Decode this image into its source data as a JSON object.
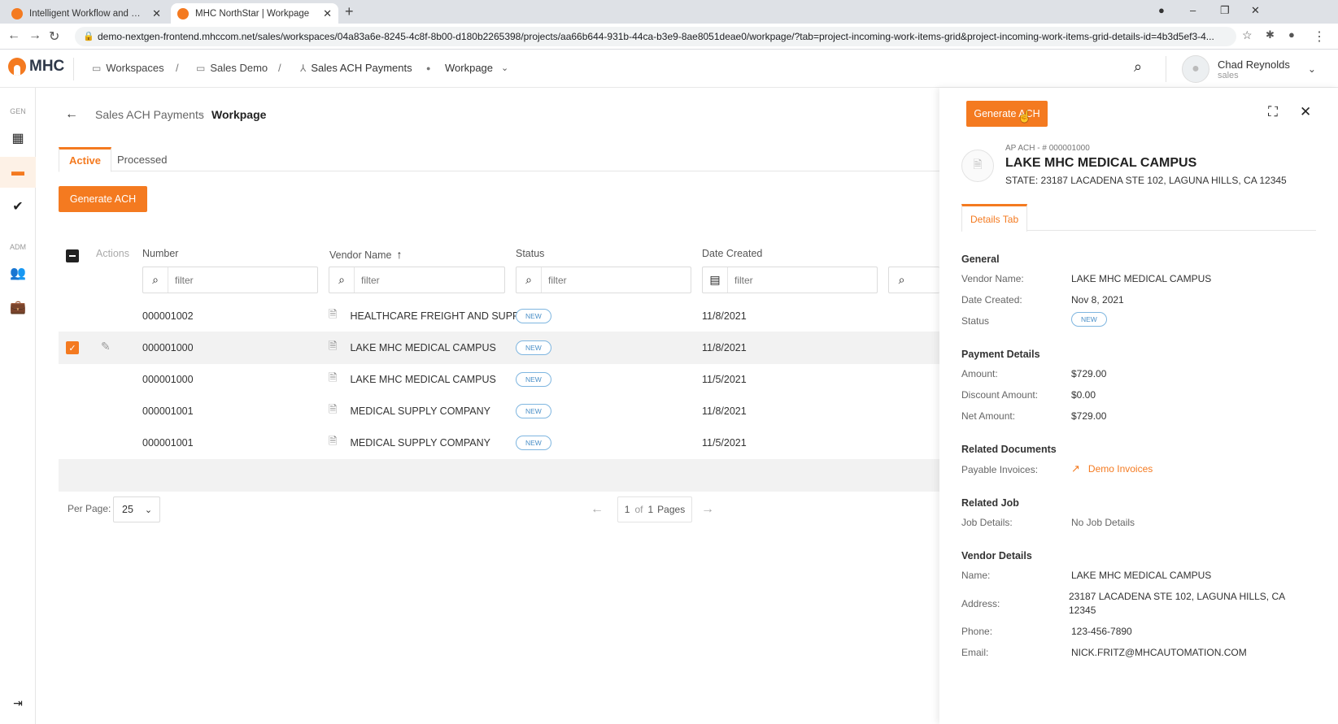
{
  "browser": {
    "tabs": [
      {
        "title": "Intelligent Workflow and Conten"
      },
      {
        "title": "MHC NorthStar | Workpage"
      }
    ],
    "url": "demo-nextgen-frontend.mhccom.net/sales/workspaces/04a83a6e-8245-4c8f-8b00-d180b2265398/projects/aa66b644-931b-44ca-b3e9-8ae8051deae0/workpage/?tab=project-incoming-work-items-grid&project-incoming-work-items-grid-details-id=4b3d5ef3-4..."
  },
  "header": {
    "logo_text": "MHC",
    "breadcrumb": [
      "Workspaces",
      "Sales Demo",
      "Sales ACH Payments",
      "Workpage"
    ],
    "user_name": "Chad Reynolds",
    "user_role": "sales"
  },
  "rail": {
    "gen_label": "GEN",
    "adm_label": "ADM"
  },
  "page": {
    "parent": "Sales ACH Payments",
    "title": "Workpage",
    "tabs": [
      "Active",
      "Processed"
    ],
    "generate_label": "Generate ACH"
  },
  "table": {
    "columns": [
      "Actions",
      "Number",
      "Vendor Name",
      "Status",
      "Date Created"
    ],
    "filter_placeholder": "filter",
    "rows": [
      {
        "number": "000001002",
        "vendor": "HEALTHCARE FREIGHT AND SUPPLY",
        "status": "NEW",
        "date": "11/8/2021"
      },
      {
        "number": "000001000",
        "vendor": "LAKE MHC MEDICAL CAMPUS",
        "status": "NEW",
        "date": "11/8/2021"
      },
      {
        "number": "000001000",
        "vendor": "LAKE MHC MEDICAL CAMPUS",
        "status": "NEW",
        "date": "11/5/2021"
      },
      {
        "number": "000001001",
        "vendor": "MEDICAL SUPPLY COMPANY",
        "status": "NEW",
        "date": "11/8/2021"
      },
      {
        "number": "000001001",
        "vendor": "MEDICAL SUPPLY COMPANY",
        "status": "NEW",
        "date": "11/5/2021"
      }
    ]
  },
  "pagination": {
    "per_page_label": "Per Page:",
    "per_page": "25",
    "current": "1",
    "of": "of",
    "total": "1",
    "pages_label": "Pages"
  },
  "panel": {
    "generate_label": "Generate ACH",
    "subtitle": "AP ACH - # 000001000",
    "title": "LAKE MHC MEDICAL CAMPUS",
    "state_line": "STATE: 23187 LACADENA STE 102, LAGUNA HILLS, CA 12345",
    "tab": "Details Tab",
    "general": {
      "heading": "General",
      "vendor_label": "Vendor Name:",
      "vendor": "LAKE MHC MEDICAL CAMPUS",
      "date_label": "Date Created:",
      "date": "Nov 8, 2021",
      "status_label": "Status",
      "status": "NEW"
    },
    "payment": {
      "heading": "Payment Details",
      "amount_label": "Amount:",
      "amount": "$729.00",
      "discount_label": "Discount Amount:",
      "discount": "$0.00",
      "net_label": "Net Amount:",
      "net": "$729.00"
    },
    "related_docs": {
      "heading": "Related Documents",
      "label": "Payable Invoices:",
      "link": "Demo Invoices"
    },
    "related_job": {
      "heading": "Related Job",
      "label": "Job Details:",
      "value": "No Job Details"
    },
    "vendor": {
      "heading": "Vendor Details",
      "name_label": "Name:",
      "name": "LAKE MHC MEDICAL CAMPUS",
      "address_label": "Address:",
      "address_line1": "23187 LACADENA STE 102, LAGUNA HILLS, CA",
      "address_line2": "12345",
      "phone_label": "Phone:",
      "phone": "123-456-7890",
      "email_label": "Email:",
      "email": "NICK.FRITZ@MHCAUTOMATION.COM"
    }
  },
  "colors": {
    "accent": "#f47a20",
    "badge": "#4a8fc7"
  }
}
